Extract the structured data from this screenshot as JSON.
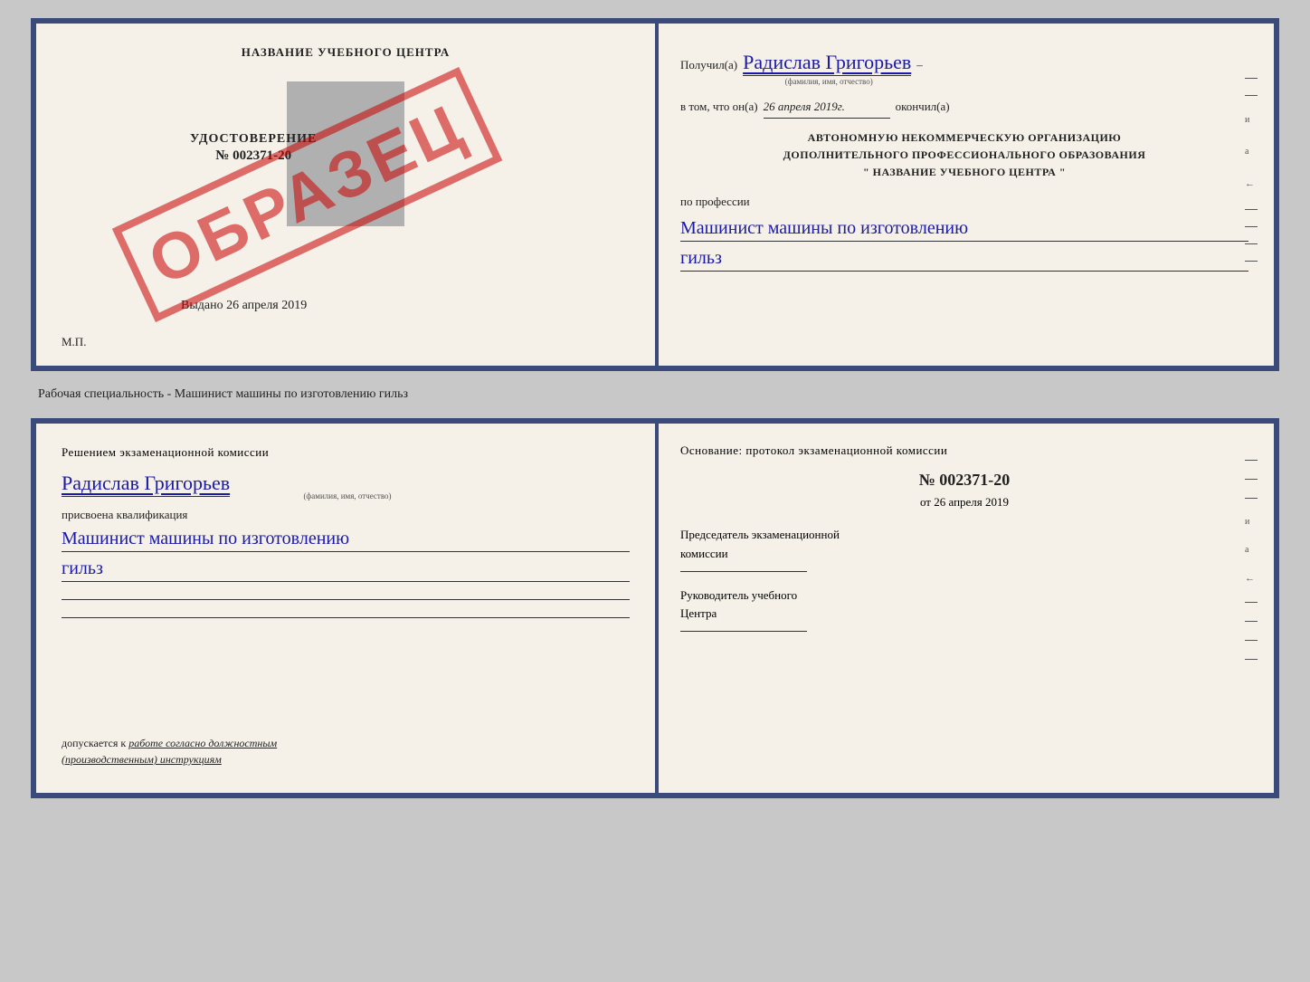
{
  "top_doc": {
    "left": {
      "title": "НАЗВАНИЕ УЧЕБНОГО ЦЕНТРА",
      "obrazec": "ОБРАЗЕЦ",
      "udostoverenie": "УДОСТОВЕРЕНИЕ",
      "nomer": "№ 002371-20",
      "vydano_label": "Выдано",
      "vydano_date": "26 апреля 2019",
      "mp": "М.П."
    },
    "right": {
      "poluchil_label": "Получил(а)",
      "recipient_name": "Радислав Григорьев",
      "fio_sub": "(фамилия, имя, отчество)",
      "dash": "–",
      "vtom_label": "в том, что он(а)",
      "date_value": "26 апреля 2019г.",
      "okonchil_label": "окончил(а)",
      "org_line1": "АВТОНОМНУЮ НЕКОММЕРЧЕСКУЮ ОРГАНИЗАЦИЮ",
      "org_line2": "ДОПОЛНИТЕЛЬНОГО ПРОФЕССИОНАЛЬНОГО ОБРАЗОВАНИЯ",
      "org_quote1": "\"",
      "org_name": "НАЗВАНИЕ УЧЕБНОГО ЦЕНТРА",
      "org_quote2": "\"",
      "po_professii": "по профессии",
      "profession_line1": "Машинист машины по изготовлению",
      "profession_line2": "гильз"
    }
  },
  "subtitle": "Рабочая специальность - Машинист машины по изготовлению гильз",
  "bottom_doc": {
    "left": {
      "resheniyem_label": "Решением  экзаменационной  комиссии",
      "name": "Радислав Григорьев",
      "fio_sub": "(фамилия, имя, отчество)",
      "prisvoena": "присвоена квалификация",
      "qualification_line1": "Машинист  машины  по  изготовлению",
      "qualification_line2": "гильз",
      "dopuskaetsya_label": "допускается к",
      "dopuskaetsya_text": "работе согласно должностным (производственным) инструкциям"
    },
    "right": {
      "osnovanie_label": "Основание: протокол экзаменационной  комиссии",
      "nomer_label": "№",
      "nomer_value": "002371-20",
      "ot_label": "от",
      "ot_date": "26 апреля 2019",
      "predsedatel_line1": "Председатель экзаменационной",
      "predsedatel_line2": "комиссии",
      "rukovoditel_line1": "Руководитель учебного",
      "rukovoditel_line2": "Центра"
    }
  }
}
